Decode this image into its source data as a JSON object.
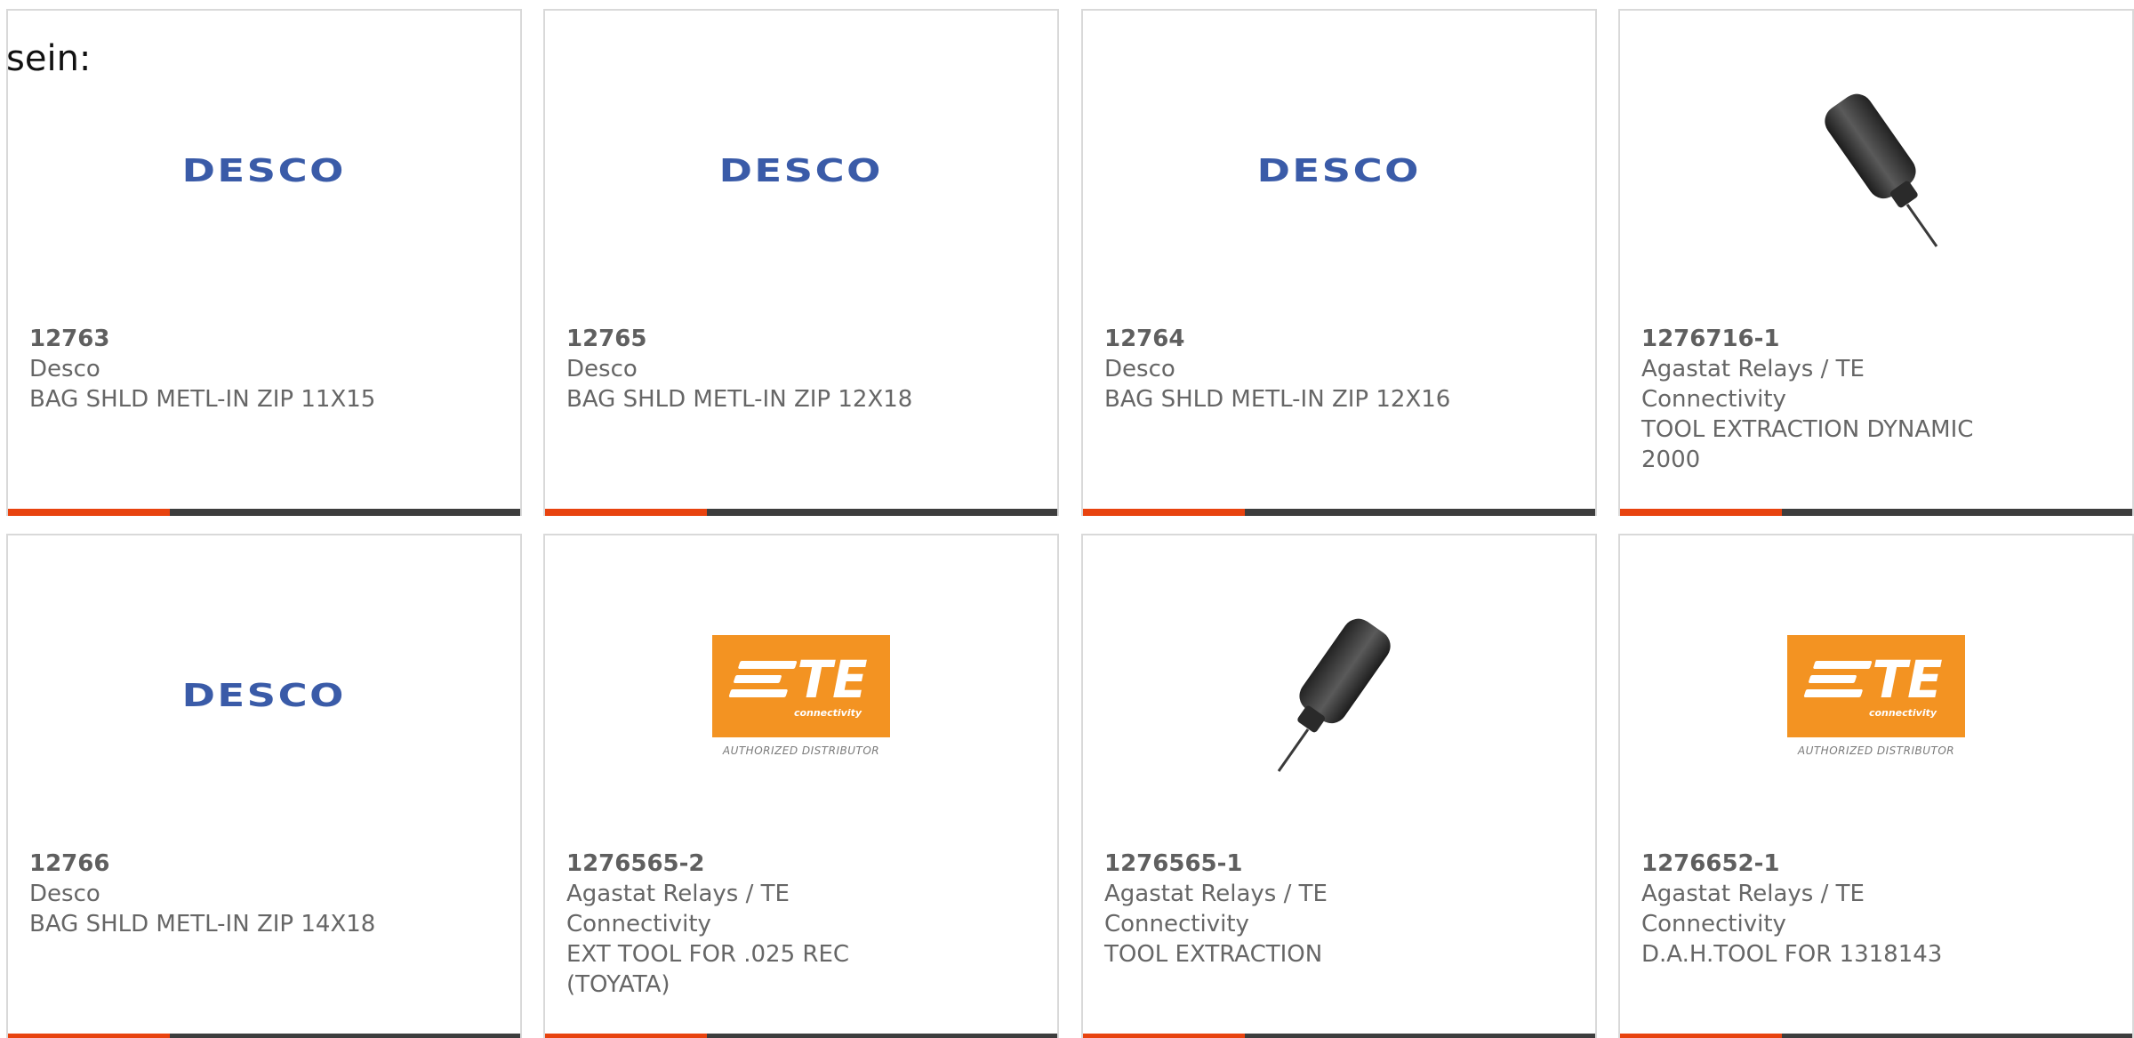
{
  "fragment_text": "sein:",
  "accent_colors": {
    "orange": "#e8430f",
    "dark": "#3d3d3d",
    "desco_blue": "#3a5ba8",
    "te_orange": "#f39322"
  },
  "logos": {
    "desco": "DESCO",
    "te_mark": "TE",
    "te_sub": "connectivity",
    "te_caption": "AUTHORIZED DISTRIBUTOR"
  },
  "products": [
    {
      "image": "desco-logo",
      "part_number": "12763",
      "manufacturer": "Desco",
      "description": "BAG SHLD METL-IN ZIP 11X15"
    },
    {
      "image": "desco-logo",
      "part_number": "12765",
      "manufacturer": "Desco",
      "description": "BAG SHLD METL-IN ZIP 12X18"
    },
    {
      "image": "desco-logo",
      "part_number": "12764",
      "manufacturer": "Desco",
      "description": "BAG SHLD METL-IN ZIP 12X16"
    },
    {
      "image": "extraction-tool-photo",
      "part_number": "1276716-1",
      "manufacturer": "Agastat Relays / TE Connectivity",
      "description": "TOOL EXTRACTION DYNAMIC 2000"
    },
    {
      "image": "desco-logo",
      "part_number": "12766",
      "manufacturer": "Desco",
      "description": "BAG SHLD METL-IN ZIP 14X18"
    },
    {
      "image": "te-logo",
      "part_number": "1276565-2",
      "manufacturer": "Agastat Relays / TE Connectivity",
      "description": "EXT TOOL FOR .025 REC (TOYATA)"
    },
    {
      "image": "extraction-tool-photo",
      "part_number": "1276565-1",
      "manufacturer": "Agastat Relays / TE Connectivity",
      "description": "TOOL EXTRACTION"
    },
    {
      "image": "te-logo",
      "part_number": "1276652-1",
      "manufacturer": "Agastat Relays / TE Connectivity",
      "description": "D.A.H.TOOL FOR 1318143"
    }
  ]
}
